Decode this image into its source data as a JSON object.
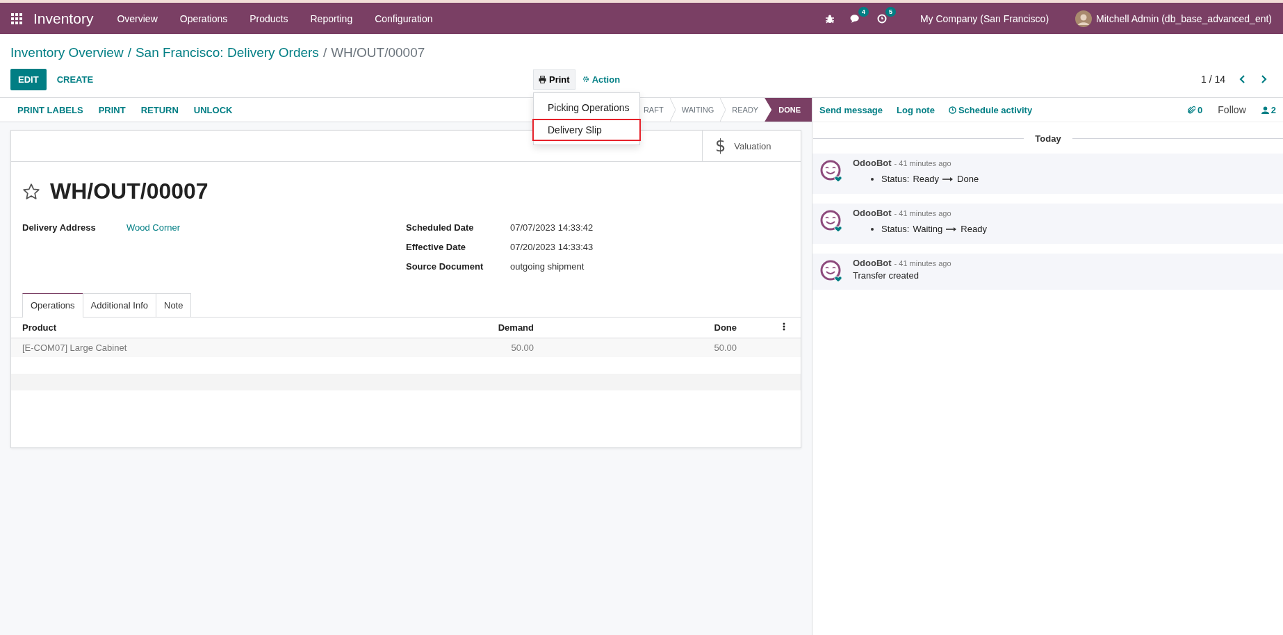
{
  "navbar": {
    "app": "Inventory",
    "menu": [
      "Overview",
      "Operations",
      "Products",
      "Reporting",
      "Configuration"
    ],
    "messages_badge": "4",
    "activities_badge": "5",
    "company": "My Company (San Francisco)",
    "user": "Mitchell Admin (db_base_advanced_ent)"
  },
  "breadcrumb_separator": "/",
  "breadcrumbs": [
    {
      "label": "Inventory Overview",
      "link": true
    },
    {
      "label": "San Francisco: Delivery Orders",
      "link": true
    },
    {
      "label": "WH/OUT/00007",
      "link": false
    }
  ],
  "buttons": [
    {
      "label": "EDIT",
      "kind": "primary"
    },
    {
      "label": "CREATE",
      "kind": "link"
    }
  ],
  "print_menu": {
    "label": "Print",
    "open": true,
    "items": [
      {
        "label": "Picking Operations",
        "highlighted": false
      },
      {
        "label": "Delivery Slip",
        "highlighted": true
      }
    ]
  },
  "action": "Action",
  "pager": "1 / 14",
  "header_buttons": [
    "PRINT LABELS",
    "PRINT",
    "RETURN",
    "UNLOCK"
  ],
  "statuses": [
    {
      "label": "RAFT",
      "selected": false
    },
    {
      "label": "WAITING",
      "selected": false
    },
    {
      "label": "READY",
      "selected": false
    },
    {
      "label": "DONE",
      "selected": true
    }
  ],
  "smart_buttons": [
    {
      "icon": "$",
      "label": "Valuation"
    }
  ],
  "record": {
    "title": "WH/OUT/00007",
    "starred": false,
    "left_fields": [
      {
        "label": "Delivery Address",
        "value": "Wood Corner",
        "kind": "link"
      }
    ],
    "right_fields": [
      {
        "label": "Scheduled Date",
        "value": "07/07/2023 14:33:42",
        "kind": "text"
      },
      {
        "label": "Effective Date",
        "value": "07/20/2023 14:33:43",
        "kind": "text"
      },
      {
        "label": "Source Document",
        "value": "outgoing shipment",
        "kind": "text"
      }
    ]
  },
  "tabs": [
    {
      "label": "Operations",
      "selected": true
    },
    {
      "label": "Additional Info",
      "selected": false
    },
    {
      "label": "Note",
      "selected": false
    }
  ],
  "table": {
    "columns": [
      "Product",
      "Demand",
      "Done"
    ],
    "rows": [
      [
        "[E-COM07] Large Cabinet",
        "50.00",
        "50.00"
      ]
    ]
  },
  "chatter": {
    "actions": [
      "Send message",
      "Log note",
      "Schedule activity"
    ],
    "attachments": "0",
    "follow": "Follow",
    "followers": "2",
    "date_separator": "Today",
    "messages": [
      {
        "author": "OdooBot",
        "time": "- 41 minutes ago",
        "kind": "tracking",
        "field": "Status:",
        "old": "Ready",
        "new": "Done"
      },
      {
        "author": "OdooBot",
        "time": "- 41 minutes ago",
        "kind": "tracking",
        "field": "Status:",
        "old": "Waiting",
        "new": "Ready"
      },
      {
        "author": "OdooBot",
        "time": "- 41 minutes ago",
        "kind": "note",
        "body": "Transfer created"
      }
    ]
  }
}
